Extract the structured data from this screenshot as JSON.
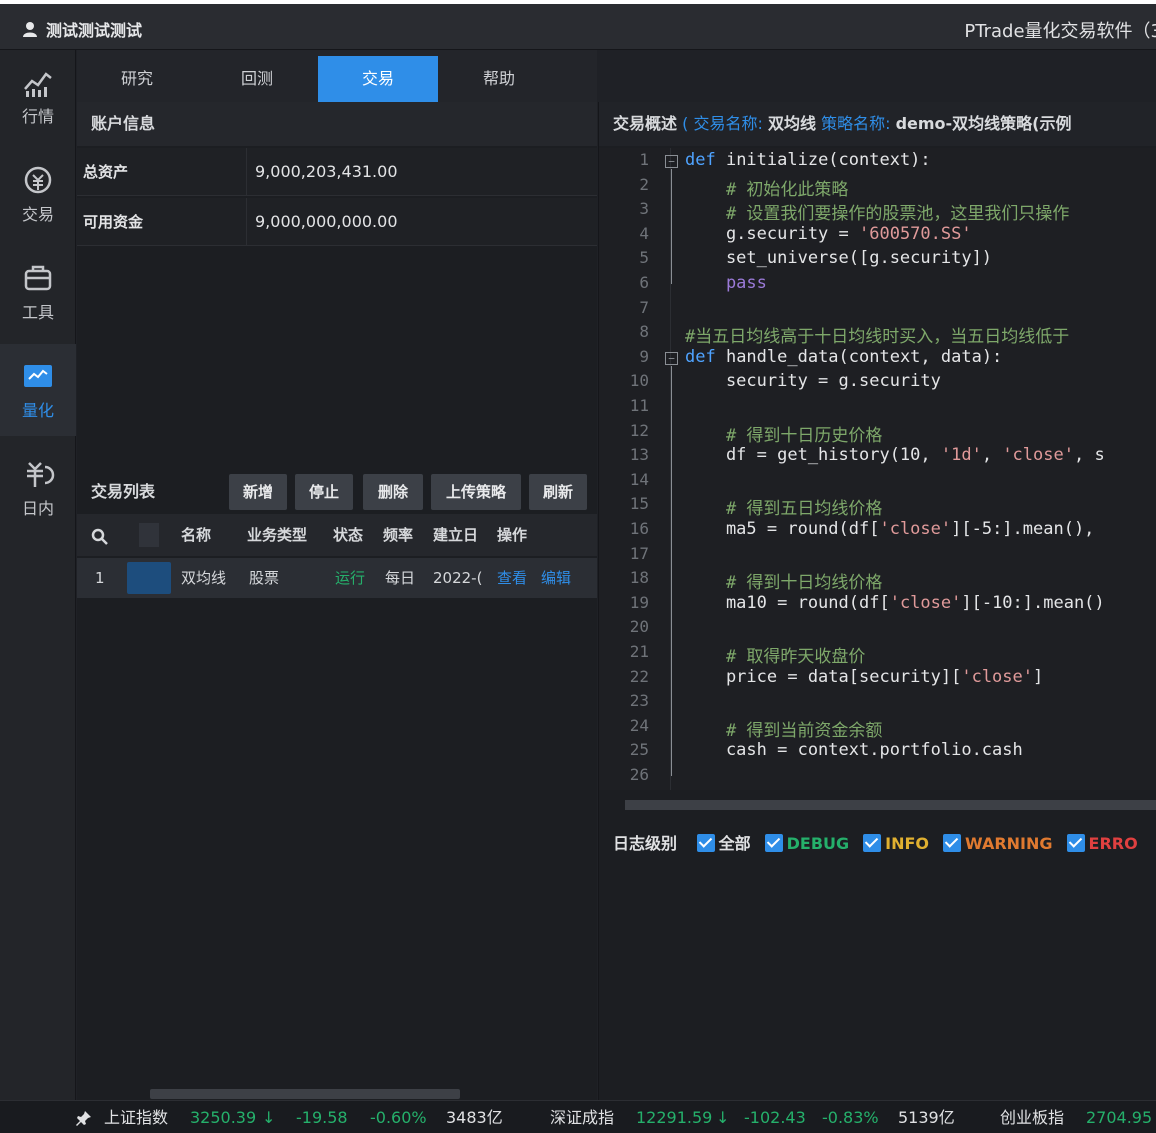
{
  "titlebar": {
    "user": "测试测试测试",
    "app_title": "PTrade量化交易软件（3"
  },
  "leftnav": [
    {
      "label": "行情",
      "icon": "chart-icon"
    },
    {
      "label": "交易",
      "icon": "trade-icon"
    },
    {
      "label": "工具",
      "icon": "toolbox-icon"
    },
    {
      "label": "量化",
      "icon": "quant-icon",
      "active": true
    },
    {
      "label": "日内",
      "icon": "intraday-icon"
    }
  ],
  "tabs": [
    "研究",
    "回测",
    "交易",
    "帮助"
  ],
  "account": {
    "title": "账户信息",
    "rows": [
      {
        "label": "总资产",
        "value": "9,000,203,431.00"
      },
      {
        "label": "可用资金",
        "value": "9,000,000,000.00"
      }
    ]
  },
  "trade_list": {
    "title": "交易列表",
    "buttons": [
      "新增",
      "停止",
      "删除",
      "上传策略",
      "刷新"
    ],
    "columns": [
      "名称",
      "业务类型",
      "状态",
      "频率",
      "建立日",
      "操作"
    ],
    "rows": [
      {
        "index": "1",
        "name": "双均线",
        "type": "股票",
        "status": "运行",
        "freq": "每日",
        "date": "2022-(",
        "op1": "查看",
        "op2": "编辑"
      }
    ]
  },
  "code_panel": {
    "label": "交易概述",
    "open_paren": "(",
    "trade_name_label": "交易名称:",
    "trade_name": "双均线",
    "strategy_label": "策略名称:",
    "strategy_name": "demo-双均线策略(示例"
  },
  "code_lines": [
    [
      {
        "t": "def ",
        "c": "kw"
      },
      {
        "t": "initialize(context):",
        "c": ""
      }
    ],
    [
      {
        "t": "    # 初始化此策略",
        "c": "cm"
      }
    ],
    [
      {
        "t": "    # 设置我们要操作的股票池，这里我们只操作",
        "c": "cm"
      }
    ],
    [
      {
        "t": "    g.security = ",
        "c": ""
      },
      {
        "t": "'600570.SS'",
        "c": "str"
      }
    ],
    [
      {
        "t": "    set_universe([g.security])",
        "c": ""
      }
    ],
    [
      {
        "t": "    pass",
        "c": "pass"
      }
    ],
    [
      {
        "t": "",
        "c": ""
      }
    ],
    [
      {
        "t": "#当五日均线高于十日均线时买入，当五日均线低于",
        "c": "cm"
      }
    ],
    [
      {
        "t": "def ",
        "c": "kw"
      },
      {
        "t": "handle_data(context, data):",
        "c": ""
      }
    ],
    [
      {
        "t": "    security = g.security",
        "c": ""
      }
    ],
    [
      {
        "t": "",
        "c": ""
      }
    ],
    [
      {
        "t": "    # 得到十日历史价格",
        "c": "cm"
      }
    ],
    [
      {
        "t": "    df = get_history(10, ",
        "c": ""
      },
      {
        "t": "'1d'",
        "c": "str"
      },
      {
        "t": ", ",
        "c": ""
      },
      {
        "t": "'close'",
        "c": "str"
      },
      {
        "t": ", s",
        "c": ""
      }
    ],
    [
      {
        "t": "",
        "c": ""
      }
    ],
    [
      {
        "t": "    # 得到五日均线价格",
        "c": "cm"
      }
    ],
    [
      {
        "t": "    ma5 = round(df[",
        "c": ""
      },
      {
        "t": "'close'",
        "c": "str"
      },
      {
        "t": "][-5:].mean(),",
        "c": ""
      }
    ],
    [
      {
        "t": "",
        "c": ""
      }
    ],
    [
      {
        "t": "    # 得到十日均线价格",
        "c": "cm"
      }
    ],
    [
      {
        "t": "    ma10 = round(df[",
        "c": ""
      },
      {
        "t": "'close'",
        "c": "str"
      },
      {
        "t": "][-10:].mean()",
        "c": ""
      }
    ],
    [
      {
        "t": "",
        "c": ""
      }
    ],
    [
      {
        "t": "    # 取得昨天收盘价",
        "c": "cm"
      }
    ],
    [
      {
        "t": "    price = data[security][",
        "c": ""
      },
      {
        "t": "'close'",
        "c": "str"
      },
      {
        "t": "]",
        "c": ""
      }
    ],
    [
      {
        "t": "",
        "c": ""
      }
    ],
    [
      {
        "t": "    # 得到当前资金余额",
        "c": "cm"
      }
    ],
    [
      {
        "t": "    cash = context.portfolio.cash",
        "c": ""
      }
    ],
    [
      {
        "t": "",
        "c": ""
      }
    ]
  ],
  "log": {
    "label": "日志级别",
    "levels": [
      {
        "name": "全部",
        "color": "#e0e1e3"
      },
      {
        "name": "DEBUG",
        "color": "#25b06b"
      },
      {
        "name": "INFO",
        "color": "#e0b030"
      },
      {
        "name": "WARNING",
        "color": "#e07a30"
      },
      {
        "name": "ERRO",
        "color": "#e04040"
      }
    ]
  },
  "statusbar": {
    "indices": [
      {
        "name": "上证指数",
        "value": "3250.39",
        "change": "-19.58",
        "pct": "-0.60%",
        "volume": "3483亿"
      },
      {
        "name": "深证成指",
        "value": "12291.59",
        "change": "-102.43",
        "pct": "-0.83%",
        "volume": "5139亿"
      },
      {
        "name": "创业板指",
        "value": "2704.95"
      }
    ]
  },
  "colors": {
    "accent": "#2f8ee8",
    "down": "#25b06b",
    "background": "#1f2126"
  }
}
